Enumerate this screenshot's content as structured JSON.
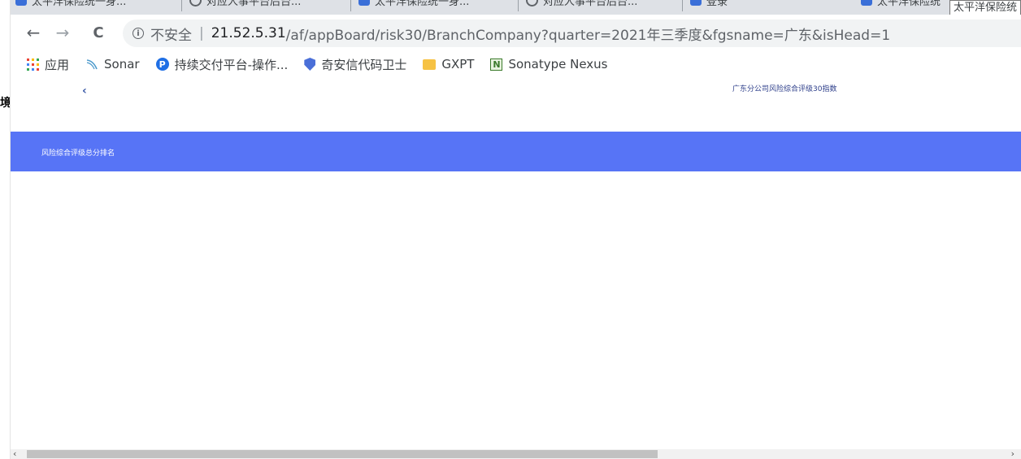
{
  "side_window": {
    "edge_char": "境"
  },
  "tabs": [
    {
      "title": "太平洋保险统一身...",
      "icon": "app-icon"
    },
    {
      "title": "对应人事平台后台...",
      "icon": "globe-icon"
    },
    {
      "title": "太平洋保险统一身...",
      "icon": "app-icon"
    },
    {
      "title": "对应人事平台后台...",
      "icon": "globe-icon"
    },
    {
      "title": "登录",
      "icon": "app-icon"
    },
    {
      "title": "太平洋保险统",
      "icon": "app-icon"
    }
  ],
  "tooltip": "太平洋保险统",
  "toolbar": {
    "back": "←",
    "forward": "→",
    "reload": "C",
    "info_icon": "i",
    "insecure_label": "不安全",
    "separator": "|",
    "url_host": "21.52.5.31",
    "url_path": "/af/appBoard/risk30/BranchCompany?quarter=2021年三季度&fgsname=广东&isHead=1"
  },
  "bookmarks": [
    {
      "label": "应用",
      "icon": "apps-grid-icon"
    },
    {
      "label": "Sonar",
      "icon": "sonar-icon"
    },
    {
      "label": "持续交付平台-操作...",
      "icon": "p-logo-icon"
    },
    {
      "label": "奇安信代码卫士",
      "icon": "shield-icon"
    },
    {
      "label": "GXPT",
      "icon": "folder-icon"
    },
    {
      "label": "Sonatype Nexus",
      "icon": "nexus-icon"
    }
  ],
  "page": {
    "back_chevron": "‹",
    "title": "广东分公司风险综合评级30指数",
    "section_label": "风险综合评级总分排名"
  },
  "scrollbar": {
    "left_arrow": "‹",
    "right_arrow": "›"
  },
  "colors": {
    "section_bar": "#5774f6",
    "title_text": "#2d3e8a",
    "tab_strip": "#dee1e6"
  }
}
